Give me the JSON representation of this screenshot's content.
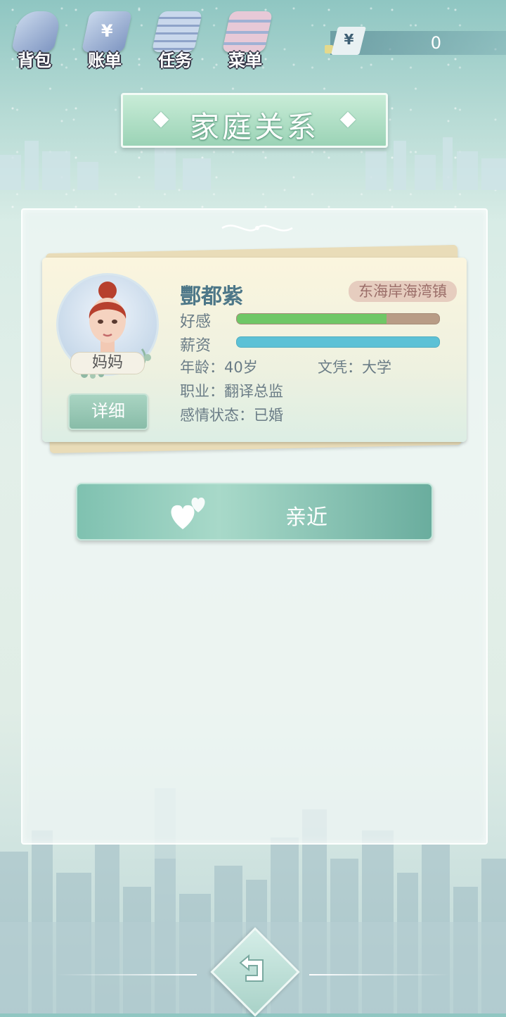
{
  "toolbar": {
    "items": [
      {
        "label": "背包",
        "icon": "backpack-icon"
      },
      {
        "label": "账单",
        "icon": "bill-icon",
        "glyph": "¥"
      },
      {
        "label": "任务",
        "icon": "task-icon"
      },
      {
        "label": "菜单",
        "icon": "menu-icon"
      }
    ]
  },
  "currency": {
    "symbol": "¥",
    "amount": "0"
  },
  "title": "家庭关系",
  "member": {
    "name": "酆都紫",
    "location": "东海岸海湾镇",
    "role": "妈妈",
    "detail_label": "详细",
    "stats": [
      {
        "label": "好感",
        "fraction": 0.74,
        "color": "#6fc766",
        "track": "#b89c86"
      },
      {
        "label": "薪资",
        "fraction": 1.0,
        "color": "#5cc1d6",
        "track": "#5cc1d6"
      }
    ],
    "age": "年龄：40岁",
    "education": "文凭：大学",
    "job": "职业：翻译总监",
    "relationship": "感情状态：已婚"
  },
  "action": {
    "label": "亲近"
  },
  "back": {
    "icon": "back-arrow-icon"
  }
}
